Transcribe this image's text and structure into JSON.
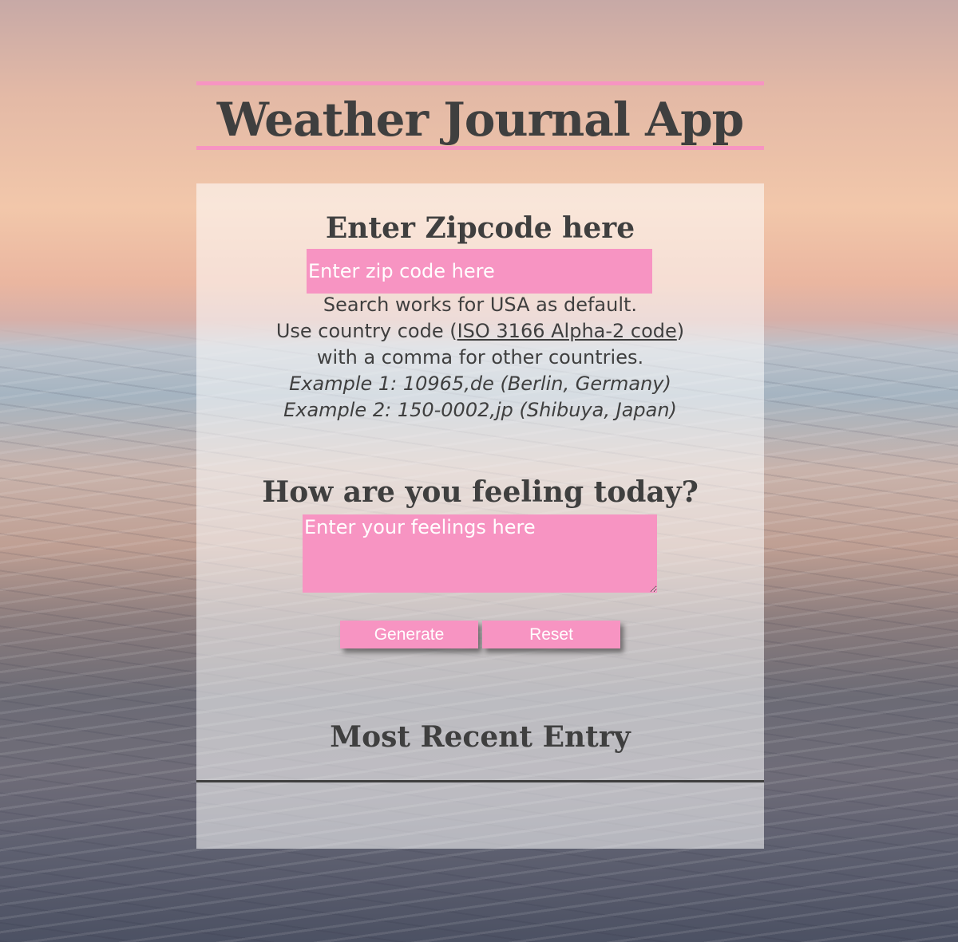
{
  "header": {
    "title": "Weather Journal App"
  },
  "zip": {
    "heading": "Enter Zipcode here",
    "placeholder": "Enter zip code here",
    "value": ""
  },
  "help": {
    "line1": "Search works for USA as default.",
    "line2_prefix": "Use country code (",
    "line2_link": "ISO 3166 Alpha-2 code",
    "line2_suffix": ")",
    "line3": "with a comma for other countries.",
    "example1": "Example 1: 10965,de (Berlin, Germany)",
    "example2": "Example 2: 150-0002,jp (Shibuya, Japan)"
  },
  "feelings": {
    "heading": "How are you feeling today?",
    "placeholder": "Enter your feelings here",
    "value": ""
  },
  "buttons": {
    "generate_label": "Generate",
    "reset_label": "Reset"
  },
  "recent": {
    "heading": "Most Recent Entry"
  },
  "colors": {
    "accent": "#f794c2",
    "text": "#3f3f3f",
    "card_background": "rgba(255,255,255,0.55)"
  }
}
